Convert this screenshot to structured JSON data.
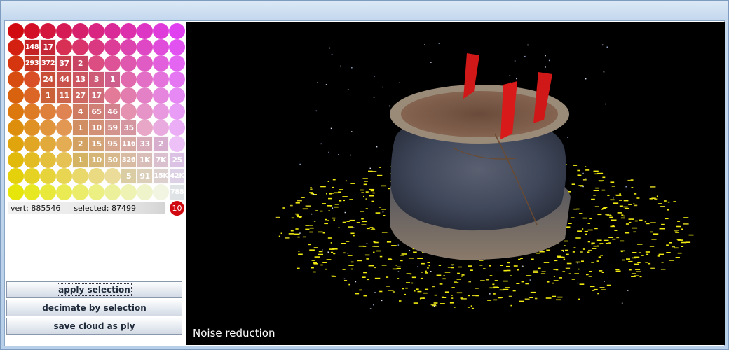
{
  "histogram": {
    "rows": [
      [
        "",
        "",
        "",
        "",
        "",
        "",
        "",
        "",
        "",
        "",
        ""
      ],
      [
        "",
        "148",
        "17",
        "",
        "",
        "",
        "",
        "",
        "",
        "",
        ""
      ],
      [
        "",
        "293",
        "372",
        "37",
        "2",
        "",
        "",
        "",
        "",
        "",
        ""
      ],
      [
        "",
        "",
        "24",
        "44",
        "13",
        "3",
        "1",
        "",
        "",
        "",
        ""
      ],
      [
        "",
        "",
        "1",
        "11",
        "27",
        "17",
        "",
        "",
        "",
        "",
        ""
      ],
      [
        "",
        "",
        "",
        "",
        "4",
        "65",
        "46",
        "",
        "",
        "",
        ""
      ],
      [
        "",
        "",
        "",
        "",
        "1",
        "10",
        "59",
        "35",
        "",
        "",
        ""
      ],
      [
        "",
        "",
        "",
        "",
        "2",
        "15",
        "95",
        "116",
        "33",
        "2",
        ""
      ],
      [
        "",
        "",
        "",
        "",
        "1",
        "10",
        "50",
        "326",
        "1K",
        "7K",
        "25"
      ],
      [
        "",
        "",
        "",
        "",
        "",
        "",
        "",
        "5",
        "91",
        "15K",
        "42K"
      ],
      [
        "",
        "",
        "",
        "",
        "",
        "",
        "",
        "",
        "",
        "",
        "788"
      ]
    ]
  },
  "status": {
    "vert_label": "vert:",
    "vert_value": "885546",
    "selected_label": "selected:",
    "selected_value": "87499",
    "badge": "10"
  },
  "buttons": {
    "apply": "apply selection",
    "decimate": "decimate by selection",
    "save": "save cloud as ply"
  },
  "viewport": {
    "label": "Noise reduction"
  },
  "colors": {
    "red": "#d10a12",
    "magenta": "#e040f0",
    "yellow": "#e6e60a",
    "viewport_bg": "#000000"
  }
}
